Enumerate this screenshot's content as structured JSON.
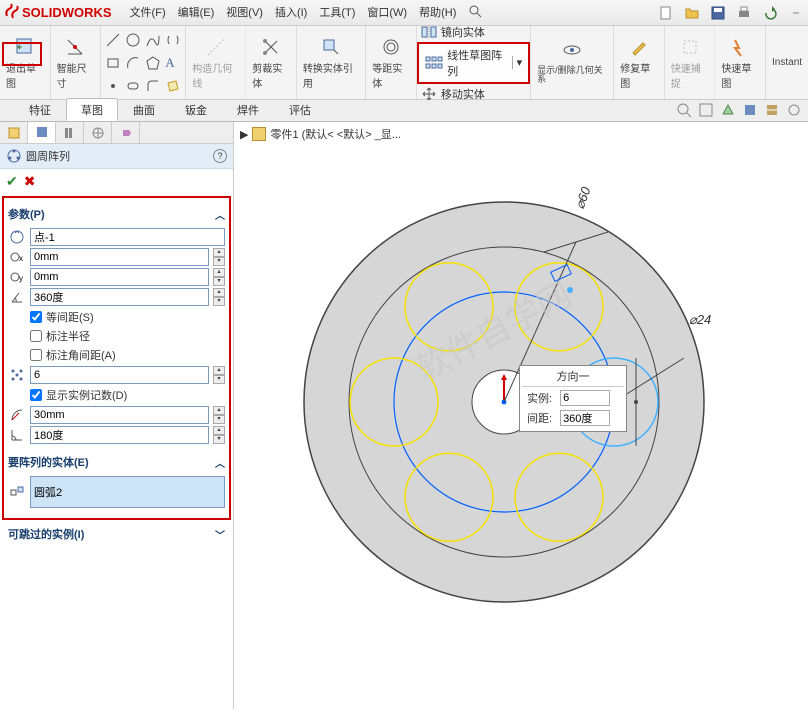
{
  "app": {
    "name": "SOLIDWORKS"
  },
  "menu": [
    "文件(F)",
    "编辑(E)",
    "视图(V)",
    "插入(I)",
    "工具(T)",
    "窗口(W)",
    "帮助(H)"
  ],
  "ribbon": {
    "exit_sketch": "退出草图",
    "smart_dim": "智能尺寸",
    "construct_geom": "构造几何线",
    "trim": "剪裁实体",
    "convert": "转换实体引用",
    "offset": "等距实体",
    "mirror": "镜向实体",
    "linear_pattern": "线性草图阵列",
    "move": "移动实体",
    "show_rel": "显示/删除几何关系",
    "repair": "修复草图",
    "quick_snap": "快速捕捉",
    "rapid": "快速草图",
    "instant": "Instant"
  },
  "tabs": [
    "特征",
    "草图",
    "曲面",
    "钣金",
    "焊件",
    "评估"
  ],
  "active_tab": "草图",
  "breadcrumb": "零件1  (默认< <默认> _显...",
  "feature": {
    "title": "圆周阵列",
    "params_hd": "参数(P)",
    "point": "点-1",
    "cx": "0mm",
    "cy": "0mm",
    "angle": "360度",
    "equal_spacing": "等间距(S)",
    "dim_radius": "标注半径",
    "dim_ang_spacing": "标注角间距(A)",
    "count": "6",
    "show_instance": "显示实例记数(D)",
    "radius": "30mm",
    "arc_angle": "180度",
    "entities_hd": "要阵列的实体(E)",
    "entity": "圆弧2",
    "skippable_hd": "可跳过的实例(I)"
  },
  "callout": {
    "title": "方向一",
    "inst_label": "实例:",
    "inst_val": "6",
    "spacing_label": "间距:",
    "spacing_val": "360度"
  },
  "dims": {
    "d60": "60",
    "d24": "24"
  }
}
